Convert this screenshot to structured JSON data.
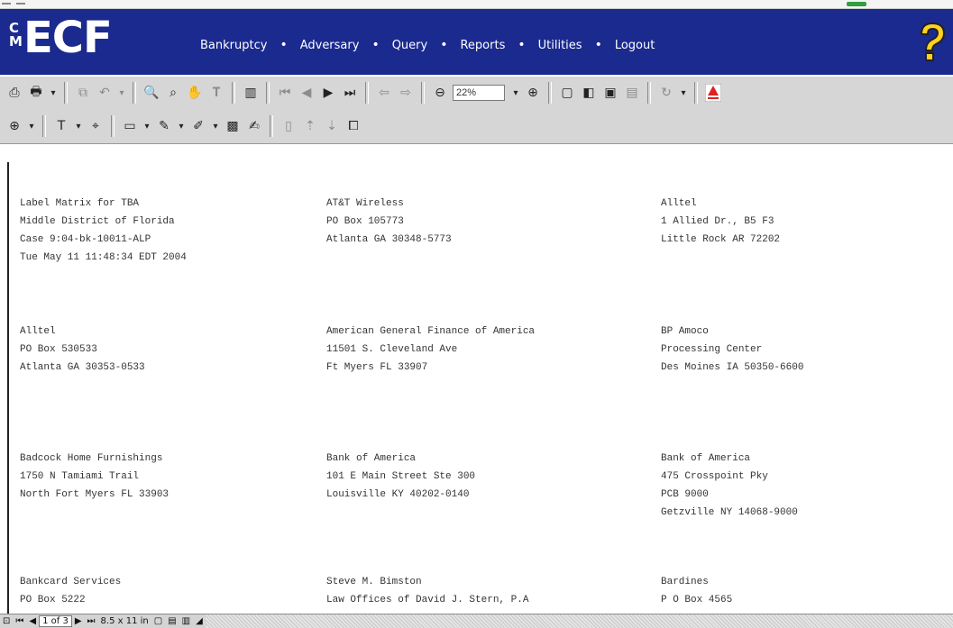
{
  "navbar": {
    "logo_cm": [
      "C",
      "M"
    ],
    "logo_ecf": "ECF",
    "menu": [
      "Bankruptcy",
      "Adversary",
      "Query",
      "Reports",
      "Utilities",
      "Logout"
    ],
    "separator": "•",
    "bg_color": "#1b2a8f"
  },
  "toolbar": {
    "zoom_value": "22%"
  },
  "document": {
    "entries": [
      [
        "Label Matrix for TBA",
        "Middle District of Florida",
        "Case 9:04-bk-10011-ALP",
        "Tue May 11 11:48:34 EDT 2004"
      ],
      [
        "AT&T Wireless",
        "PO Box 105773",
        "Atlanta GA 30348-5773"
      ],
      [
        "Alltel",
        "1 Allied Dr., B5 F3",
        "Little Rock AR 72202"
      ],
      [
        "Alltel",
        "PO Box 530533",
        "Atlanta GA 30353-0533"
      ],
      [
        "American General Finance of America",
        "11501 S. Cleveland Ave",
        "Ft Myers FL 33907"
      ],
      [
        "BP Amoco",
        "Processing Center",
        "Des Moines IA 50350-6600"
      ],
      [
        "Badcock Home Furnishings",
        "1750 N Tamiami Trail",
        "North Fort Myers FL 33903"
      ],
      [
        "Bank of America",
        "101 E Main Street Ste 300",
        "Louisville KY 40202-0140"
      ],
      [
        "Bank of America",
        "475 Crosspoint Pky",
        "PCB 9000",
        "Getzville NY 14068-9000"
      ],
      [
        "Bankcard Services",
        "PO Box 5222"
      ],
      [
        "Steve M. Bimston",
        "Law Offices of David J. Stern, P.A"
      ],
      [
        "Bardines",
        "P O Box 4565"
      ]
    ]
  },
  "status": {
    "page_indicator": "1 of 3",
    "page_size": "8.5 x 11 in"
  }
}
